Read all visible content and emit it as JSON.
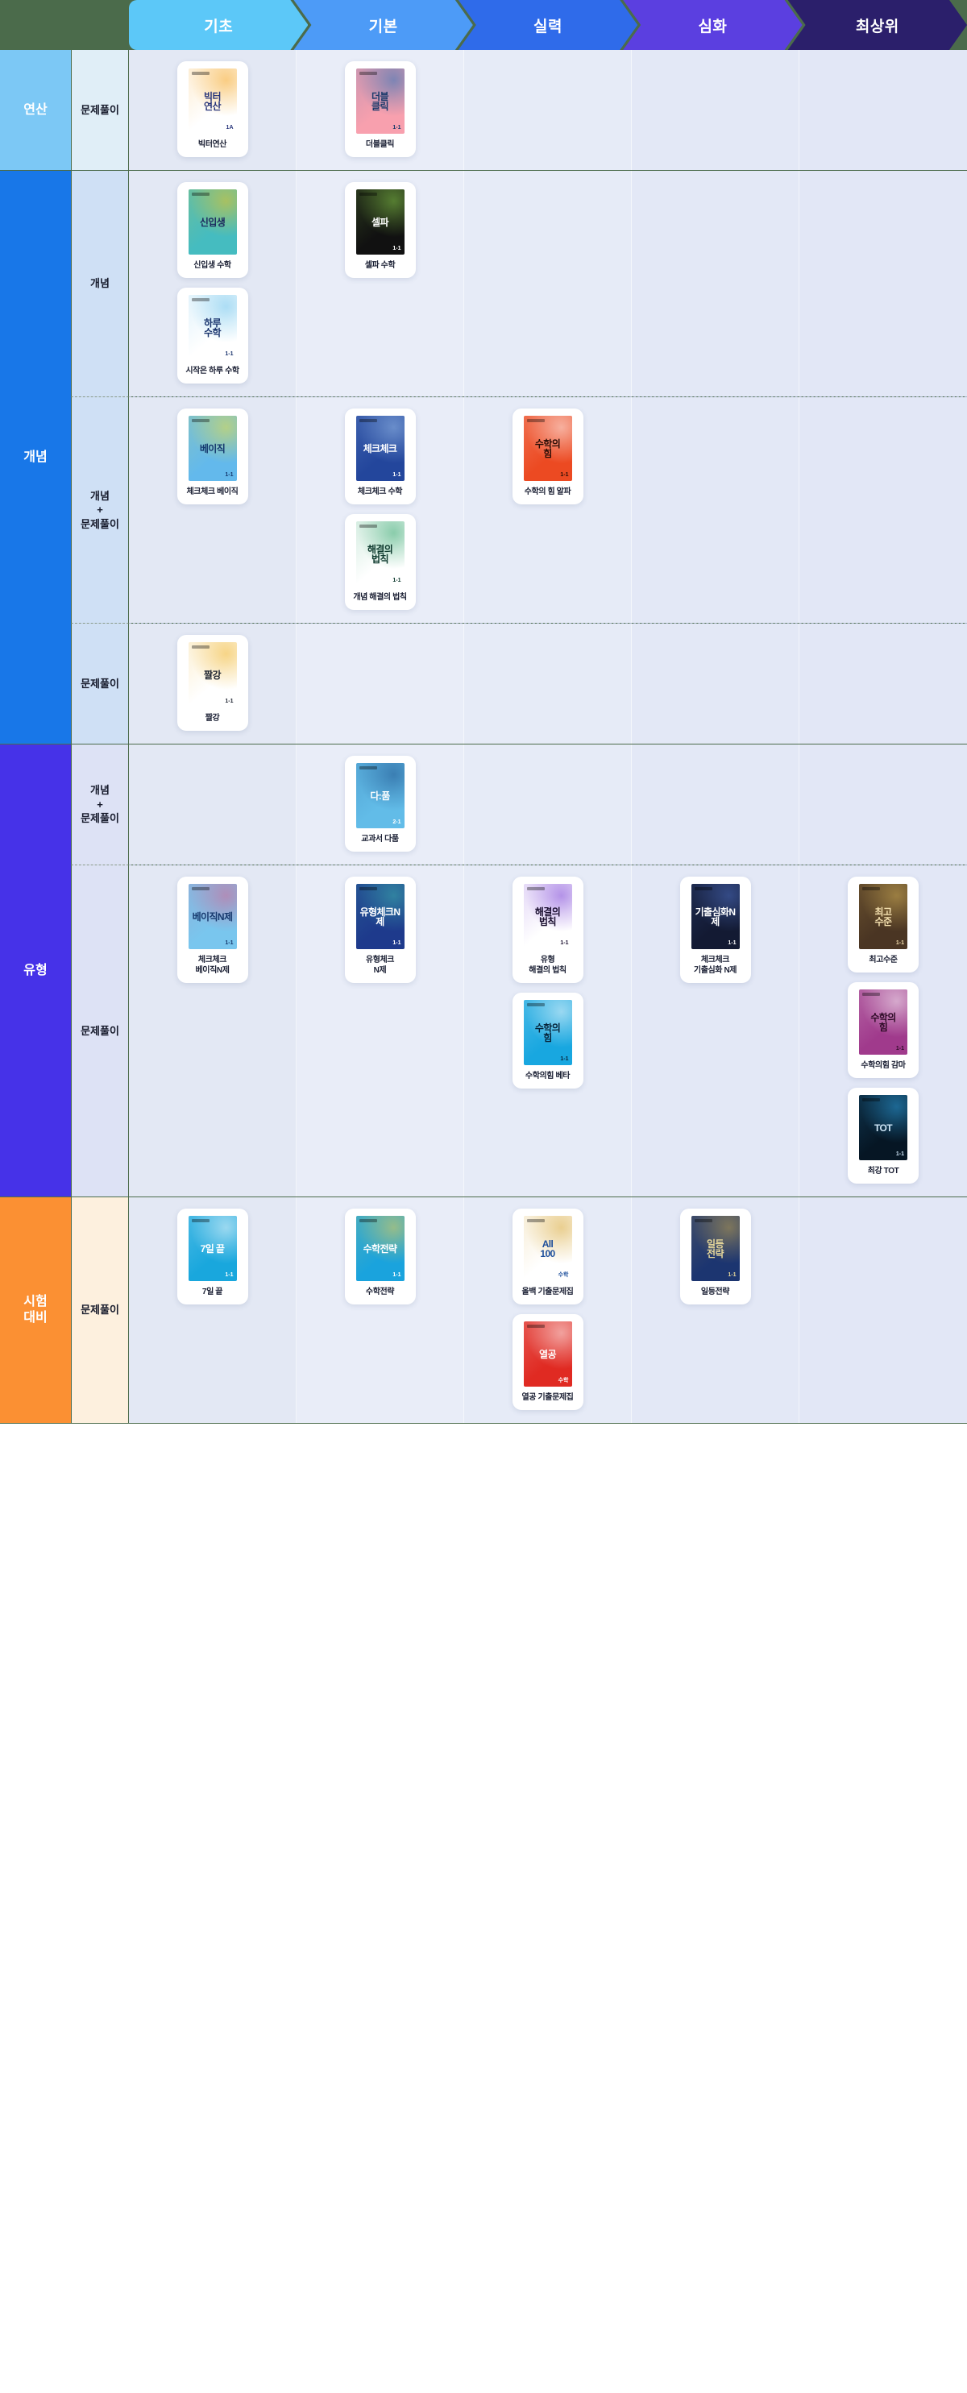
{
  "columns": [
    {
      "label": "기초",
      "color": "#5cc8f8"
    },
    {
      "label": "기본",
      "color": "#4d9bf7"
    },
    {
      "label": "실력",
      "color": "#2f6bea"
    },
    {
      "label": "심화",
      "color": "#5b3fe0"
    },
    {
      "label": "최상위",
      "color": "#2b1f6b"
    }
  ],
  "column_body_bg": [
    "#e3e8f4",
    "#e9edf8",
    "#e6ebf7",
    "#e3e8f6",
    "#e2e7f6"
  ],
  "rows": [
    {
      "level1": "연산",
      "level1_color": "#7cc8f5",
      "level2": "문제풀이",
      "level2_bg": "#e0eef7",
      "dashed_bottom": false,
      "cells": [
        [
          {
            "title": "빅터연산",
            "cover_bg": "#ffffff",
            "cover_fg": "#27347a",
            "cover_text": "빅터\n연산",
            "cover_sub": "1A",
            "accent": "#f5a623"
          }
        ],
        [
          {
            "title": "더블클릭",
            "cover_bg": "#f8a0ae",
            "cover_fg": "#1a3a6b",
            "cover_text": "더블\n클릭",
            "cover_sub": "1-1",
            "accent": "#1f6fb8"
          }
        ],
        [],
        [],
        []
      ]
    },
    {
      "level1": "개념",
      "level1_color": "#1877e8",
      "level1_rowspan": 3,
      "level2": "개념",
      "level2_bg": "#cfe0f5",
      "dashed_bottom": true,
      "cells": [
        [
          {
            "title": "신입생 수학",
            "cover_bg": "#45bcc0",
            "cover_fg": "#1b2a5e",
            "cover_text": "신입생",
            "cover_sub": "",
            "accent": "#f5c518"
          },
          {
            "title": "시작은 하루 수학",
            "cover_bg": "#ffffff",
            "cover_fg": "#17316b",
            "cover_text": "하루\n수학",
            "cover_sub": "1-1",
            "accent": "#6cc3ec"
          }
        ],
        [
          {
            "title": "셀파 수학",
            "cover_bg": "#111111",
            "cover_fg": "#ffffff",
            "cover_text": "셀파",
            "cover_sub": "1-1",
            "accent": "#8ad04a"
          }
        ],
        [],
        [],
        []
      ]
    },
    {
      "level1": null,
      "level2": "개념\n+\n문제풀이",
      "level2_bg": "#cfe0f5",
      "dashed_bottom": true,
      "cells": [
        [
          {
            "title": "체크체크 베이직",
            "cover_bg": "#63b9ec",
            "cover_fg": "#15386e",
            "cover_text": "베이직",
            "cover_sub": "1-1",
            "accent": "#f2e23a"
          }
        ],
        [
          {
            "title": "체크체크 수학",
            "cover_bg": "#23469c",
            "cover_fg": "#ffffff",
            "cover_text": "체크체크",
            "cover_sub": "1-1",
            "accent": "#9fc4ee"
          },
          {
            "title": "개념 해결의 법칙",
            "cover_bg": "#ffffff",
            "cover_fg": "#0f3b2f",
            "cover_text": "해결의\n법칙",
            "cover_sub": "1-1",
            "accent": "#2fa56a"
          }
        ],
        [
          {
            "title": "수학의 힘 알파",
            "cover_bg": "#ec4a22",
            "cover_fg": "#2a0d06",
            "cover_text": "수학의\n힘",
            "cover_sub": "1-1",
            "accent": "#ffffff"
          }
        ],
        [],
        []
      ]
    },
    {
      "level1": null,
      "level2": "문제풀이",
      "level2_bg": "#cfe0f5",
      "dashed_bottom": false,
      "cells": [
        [
          {
            "title": "짤강",
            "cover_bg": "#ffffff",
            "cover_fg": "#1d2330",
            "cover_text": "짤강",
            "cover_sub": "1-1",
            "accent": "#f0b429"
          }
        ],
        [],
        [],
        [],
        []
      ]
    },
    {
      "level1": "유형",
      "level1_color": "#4632e8",
      "level1_rowspan": 2,
      "level2": "개념\n+\n문제풀이",
      "level2_bg": "#dde2f5",
      "dashed_bottom": true,
      "cells": [
        [],
        [
          {
            "title": "교과서 다품",
            "cover_bg": "#62bce8",
            "cover_fg": "#ffffff",
            "cover_text": "다:품",
            "cover_sub": "2-1",
            "accent": "#1c4f8a"
          }
        ],
        [],
        [],
        []
      ]
    },
    {
      "level1": null,
      "level2": "문제풀이",
      "level2_bg": "#dde2f5",
      "dashed_bottom": false,
      "cells": [
        [
          {
            "title": "체크체크\n베이직N제",
            "cover_bg": "#79c6ee",
            "cover_fg": "#16386d",
            "cover_text": "베이직N제",
            "cover_sub": "1-1",
            "accent": "#d9628f"
          }
        ],
        [
          {
            "title": "유형체크\nN제",
            "cover_bg": "#1e3a8c",
            "cover_fg": "#ffffff",
            "cover_text": "유형체크N제",
            "cover_sub": "1-1",
            "accent": "#3fb9b0"
          }
        ],
        [
          {
            "title": "유형\n해결의 법칙",
            "cover_bg": "#ffffff",
            "cover_fg": "#1b1030",
            "cover_text": "해결의\n법칙",
            "cover_sub": "1-1",
            "accent": "#7a3fd6"
          },
          {
            "title": "수학의힘 베타",
            "cover_bg": "#18a7e0",
            "cover_fg": "#07243a",
            "cover_text": "수학의\n힘",
            "cover_sub": "1-1",
            "accent": "#ffffff"
          }
        ],
        [
          {
            "title": "체크체크\n기출심화 N제",
            "cover_bg": "#131a33",
            "cover_fg": "#ffffff",
            "cover_text": "기출심화N제",
            "cover_sub": "1-1",
            "accent": "#4d6fc4"
          }
        ],
        [
          {
            "title": "최고수준",
            "cover_bg": "#4a3523",
            "cover_fg": "#f3dfae",
            "cover_text": "최고\n수준",
            "cover_sub": "1-1",
            "accent": "#d8b559"
          },
          {
            "title": "수학의힘 감마",
            "cover_bg": "#a03a8c",
            "cover_fg": "#2d0b26",
            "cover_text": "수학의\n힘",
            "cover_sub": "1-1",
            "accent": "#ffffff"
          },
          {
            "title": "최강 TOT",
            "cover_bg": "#061624",
            "cover_fg": "#cfe6f7",
            "cover_text": "TOT",
            "cover_sub": "1-1",
            "accent": "#2ea6e8"
          }
        ]
      ]
    },
    {
      "level1": "시험\n대비",
      "level1_color": "#fb9033",
      "level2": "문제풀이",
      "level2_bg": "#fdf0de",
      "dashed_bottom": false,
      "cells": [
        [
          {
            "title": "7일 끝",
            "cover_bg": "#19a7dd",
            "cover_fg": "#ffffff",
            "cover_text": "7일 끝",
            "cover_sub": "1-1",
            "accent": "#ffffff"
          }
        ],
        [
          {
            "title": "수학전략",
            "cover_bg": "#1aa3dd",
            "cover_fg": "#ffffff",
            "cover_text": "수학전략",
            "cover_sub": "1-1",
            "accent": "#f5d04a"
          }
        ],
        [
          {
            "title": "올백 기출문제집",
            "cover_bg": "#ffffff",
            "cover_fg": "#1e4f9c",
            "cover_text": "All\n100",
            "cover_sub": "수학",
            "accent": "#d9a93a"
          },
          {
            "title": "열공 기출문제집",
            "cover_bg": "#e02a22",
            "cover_fg": "#ffffff",
            "cover_text": "열공",
            "cover_sub": "수학",
            "accent": "#ffffff"
          }
        ],
        [
          {
            "title": "일등전략",
            "cover_bg": "#1c3570",
            "cover_fg": "#e6d79a",
            "cover_text": "일등\n전략",
            "cover_sub": "1-1",
            "accent": "#c9a84c"
          }
        ],
        []
      ]
    }
  ]
}
